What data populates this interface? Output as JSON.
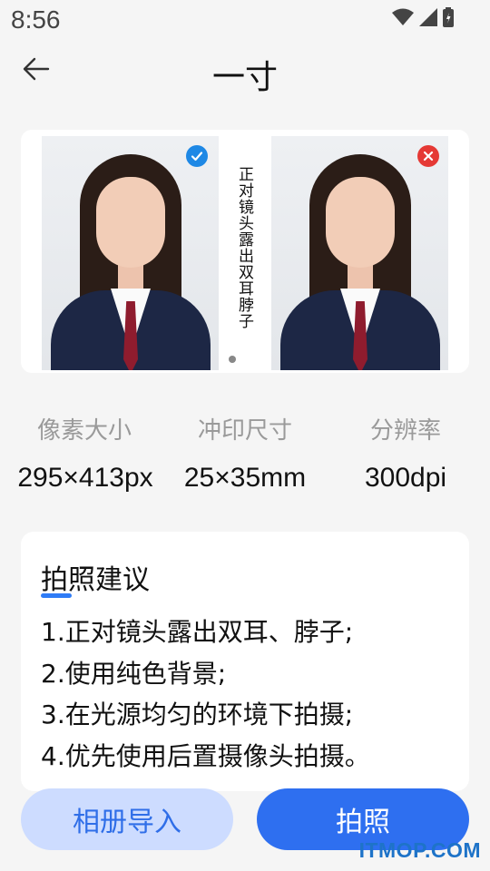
{
  "status_bar": {
    "time": "8:56",
    "icons": [
      "wifi-icon",
      "signal-icon",
      "battery-icon"
    ]
  },
  "header": {
    "title": "一寸",
    "back_icon": "arrow-left-icon"
  },
  "sample": {
    "good_badge_icon": "check-circle-icon",
    "bad_badge_icon": "close-circle-icon",
    "tip_vertical": "正对镜头露出双耳脖子",
    "colors": {
      "ok": "#1e88e5",
      "error": "#e53935"
    }
  },
  "specs": [
    {
      "label": "像素大小",
      "value": "295×413px"
    },
    {
      "label": "冲印尺寸",
      "value": "25×35mm"
    },
    {
      "label": "分辨率",
      "value": "300dpi"
    }
  ],
  "tips": {
    "title": "拍照建议",
    "items": [
      "1.正对镜头露出双耳、脖子;",
      "2.使用纯色背景;",
      "3.在光源均匀的环境下拍摄;",
      "4.优先使用后置摄像头拍摄。"
    ]
  },
  "actions": {
    "import_label": "相册导入",
    "shoot_label": "拍照",
    "accent": "#2e6ff0"
  },
  "watermark": "ITMOP.COM"
}
